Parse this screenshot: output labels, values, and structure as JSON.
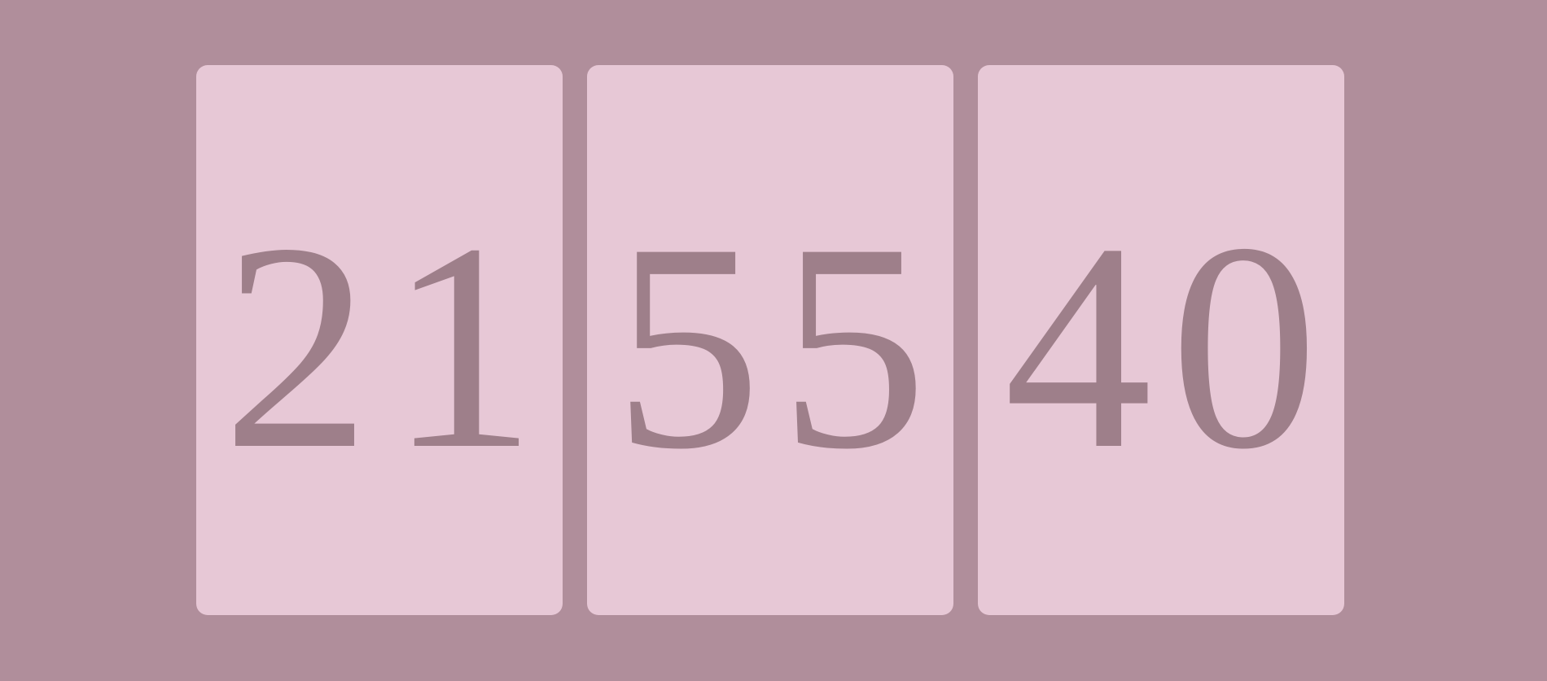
{
  "clock": {
    "hours": "21",
    "minutes": "55",
    "seconds": "40"
  },
  "colors": {
    "background": "#b08e9b",
    "card": "#e7c8d6",
    "digits": "#9e7f8a"
  }
}
